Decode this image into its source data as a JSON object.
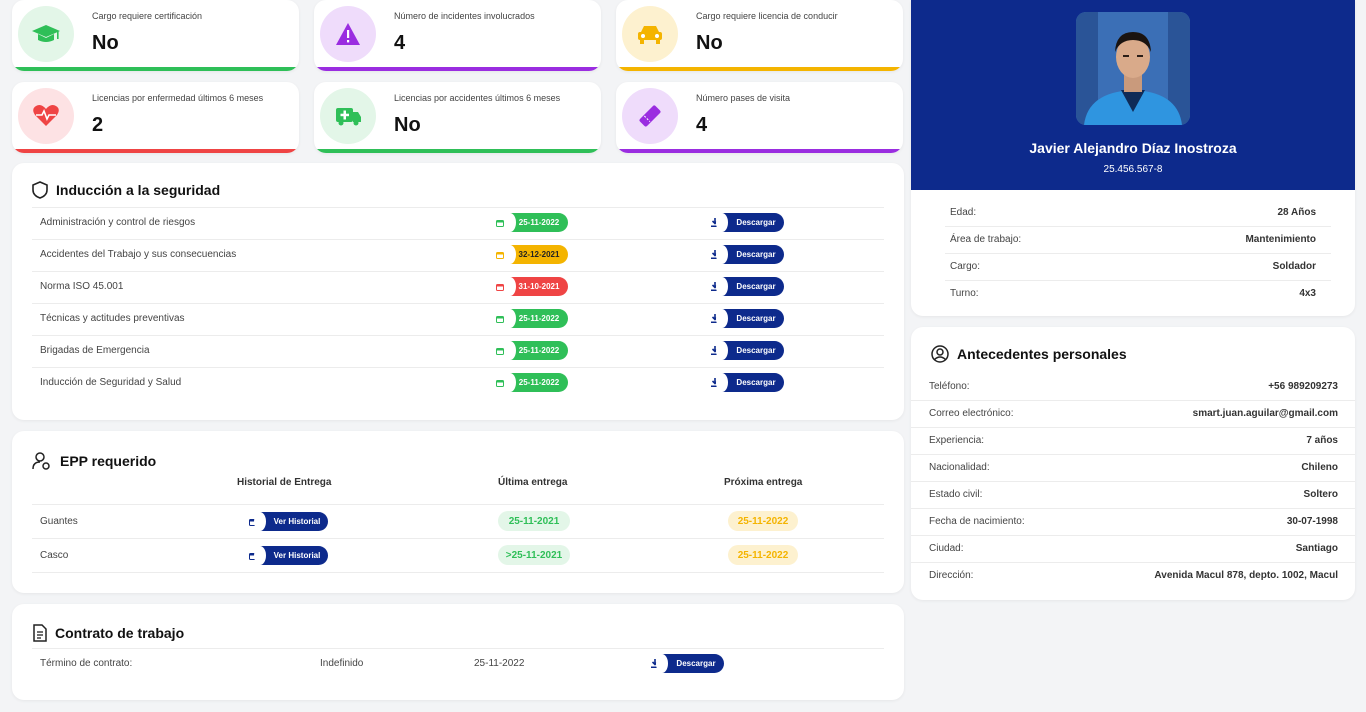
{
  "colors": {
    "navy": "#0d2a8c",
    "green": "#2fbf58",
    "purple": "#9a2de0",
    "orange": "#f4b400",
    "red": "#ef4444"
  },
  "stats": [
    {
      "label": "Cargo requiere certificación",
      "value": "No",
      "icon": "graduation-cap-icon",
      "color": "#2fbf58"
    },
    {
      "label": "Número de incidentes involucrados",
      "value": "4",
      "icon": "warning-triangle-icon",
      "color": "#9a2de0"
    },
    {
      "label": "Cargo requiere licencia de conducir",
      "value": "No",
      "icon": "car-icon",
      "color": "#f4b400"
    },
    {
      "label": "Licencias por enfermedad últimos 6 meses",
      "value": "2",
      "icon": "heartbeat-icon",
      "color": "#ef4444"
    },
    {
      "label": "Licencias por accidentes últimos 6 meses",
      "value": "No",
      "icon": "ambulance-icon",
      "color": "#2fbf58"
    },
    {
      "label": "Número pases de visita",
      "value": "4",
      "icon": "ticket-icon",
      "color": "#9a2de0"
    }
  ],
  "induction": {
    "title": "Inducción a la seguridad",
    "download_label": "Descargar",
    "items": [
      {
        "name": "Administración y control de riesgos",
        "date": "25-11-2022",
        "status": "green"
      },
      {
        "name": "Accidentes del Trabajo y sus consecuencias",
        "date": "32-12-2021",
        "status": "orange"
      },
      {
        "name": "Norma ISO 45.001",
        "date": "31-10-2021",
        "status": "red"
      },
      {
        "name": "Técnicas y actitudes preventivas",
        "date": "25-11-2022",
        "status": "green"
      },
      {
        "name": "Brigadas de Emergencia",
        "date": "25-11-2022",
        "status": "green"
      },
      {
        "name": "Inducción de Seguridad y Salud",
        "date": "25-11-2022",
        "status": "green"
      }
    ]
  },
  "epp": {
    "title": "EPP requerido",
    "headers": [
      "Historial de Entrega",
      "Última entrega",
      "Próxima entrega"
    ],
    "history_label": "Ver Historial",
    "items": [
      {
        "name": "Guantes",
        "last": "25-11-2021",
        "next": "25-11-2022"
      },
      {
        "name": "Casco",
        "last": ">25-11-2021",
        "next": "25-11-2022"
      }
    ]
  },
  "contract": {
    "title": "Contrato de trabajo",
    "term_label": "Término de contrato:",
    "term_value": "Indefinido",
    "date": "25-11-2022",
    "download_label": "Descargar"
  },
  "profile": {
    "name": "Javier Alejandro Díaz Inostroza",
    "rut": "25.456.567-8",
    "fields": [
      {
        "label": "Edad:",
        "value": "28 Años"
      },
      {
        "label": "Área de trabajo:",
        "value": "Mantenimiento"
      },
      {
        "label": "Cargo:",
        "value": "Soldador"
      },
      {
        "label": "Turno:",
        "value": "4x3"
      }
    ]
  },
  "personal": {
    "title": "Antecedentes personales",
    "fields": [
      {
        "label": "Teléfono:",
        "value": "+56 989209273"
      },
      {
        "label": "Correo electrónico:",
        "value": "smart.juan.aguilar@gmail.com"
      },
      {
        "label": "Experiencia:",
        "value": "7 años"
      },
      {
        "label": "Nacionalidad:",
        "value": "Chileno"
      },
      {
        "label": "Estado civil:",
        "value": "Soltero"
      },
      {
        "label": "Fecha de nacimiento:",
        "value": "30-07-1998"
      },
      {
        "label": "Ciudad:",
        "value": "Santiago"
      },
      {
        "label": "Dirección:",
        "value": "Avenida Macul 878, depto. 1002, Macul"
      }
    ]
  }
}
